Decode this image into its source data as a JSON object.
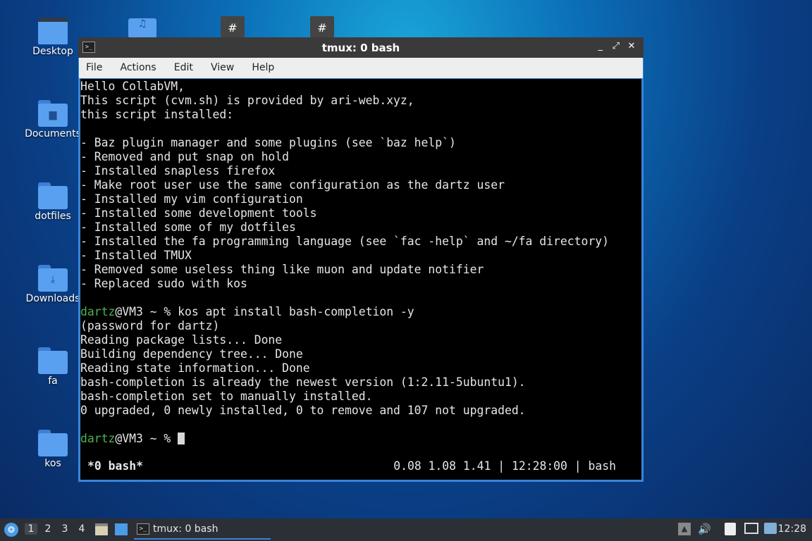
{
  "desktop": {
    "icons": [
      {
        "label": "Desktop"
      },
      {
        "label": "Documents"
      },
      {
        "label": "dotfiles"
      },
      {
        "label": "Downloads"
      },
      {
        "label": "fa"
      },
      {
        "label": "kos"
      }
    ]
  },
  "window": {
    "title": "tmux: 0 bash",
    "app_icon": ">_",
    "controls": {
      "minimize": "_",
      "maximize": "⤢",
      "close": "✕"
    },
    "menu": [
      "File",
      "Actions",
      "Edit",
      "View",
      "Help"
    ]
  },
  "terminal": {
    "lines": [
      "Hello CollabVM,",
      "This script (cvm.sh) is provided by ari-web.xyz,",
      "this script installed:",
      "",
      "- Baz plugin manager and some plugins (see `baz help`)",
      "- Removed and put snap on hold",
      "- Installed snapless firefox",
      "- Make root user use the same configuration as the dartz user",
      "- Installed my vim configuration",
      "- Installed some development tools",
      "- Installed some of my dotfiles",
      "- Installed the fa programming language (see `fac -help` and ~/fa directory)",
      "- Installed TMUX",
      "- Removed some useless thing like muon and update notifier",
      "- Replaced sudo with kos",
      ""
    ],
    "prompt1": {
      "user": "dartz",
      "rest": "@VM3 ~ % kos apt install bash-completion -y"
    },
    "output_lines": [
      "(password for dartz)",
      "Reading package lists... Done",
      "Building dependency tree... Done",
      "Reading state information... Done",
      "bash-completion is already the newest version (1:2.11-5ubuntu1).",
      "bash-completion set to manually installed.",
      "0 upgraded, 0 newly installed, 0 to remove and 107 not upgraded.",
      ""
    ],
    "prompt2": {
      "user": "dartz",
      "rest": "@VM3 ~ % "
    },
    "status_left": "*0 bash*",
    "status_right": "0.08 1.08 1.41 | 12:28:00 | bash"
  },
  "taskbar": {
    "workspaces": [
      "1",
      "2",
      "3",
      "4"
    ],
    "active_workspace": "1",
    "task_label": "tmux: 0 bash",
    "clock": "12:28"
  },
  "colors": {
    "window_border": "#3a84d8",
    "prompt_user": "#4fb04f",
    "taskbar": "#2b2f36"
  }
}
